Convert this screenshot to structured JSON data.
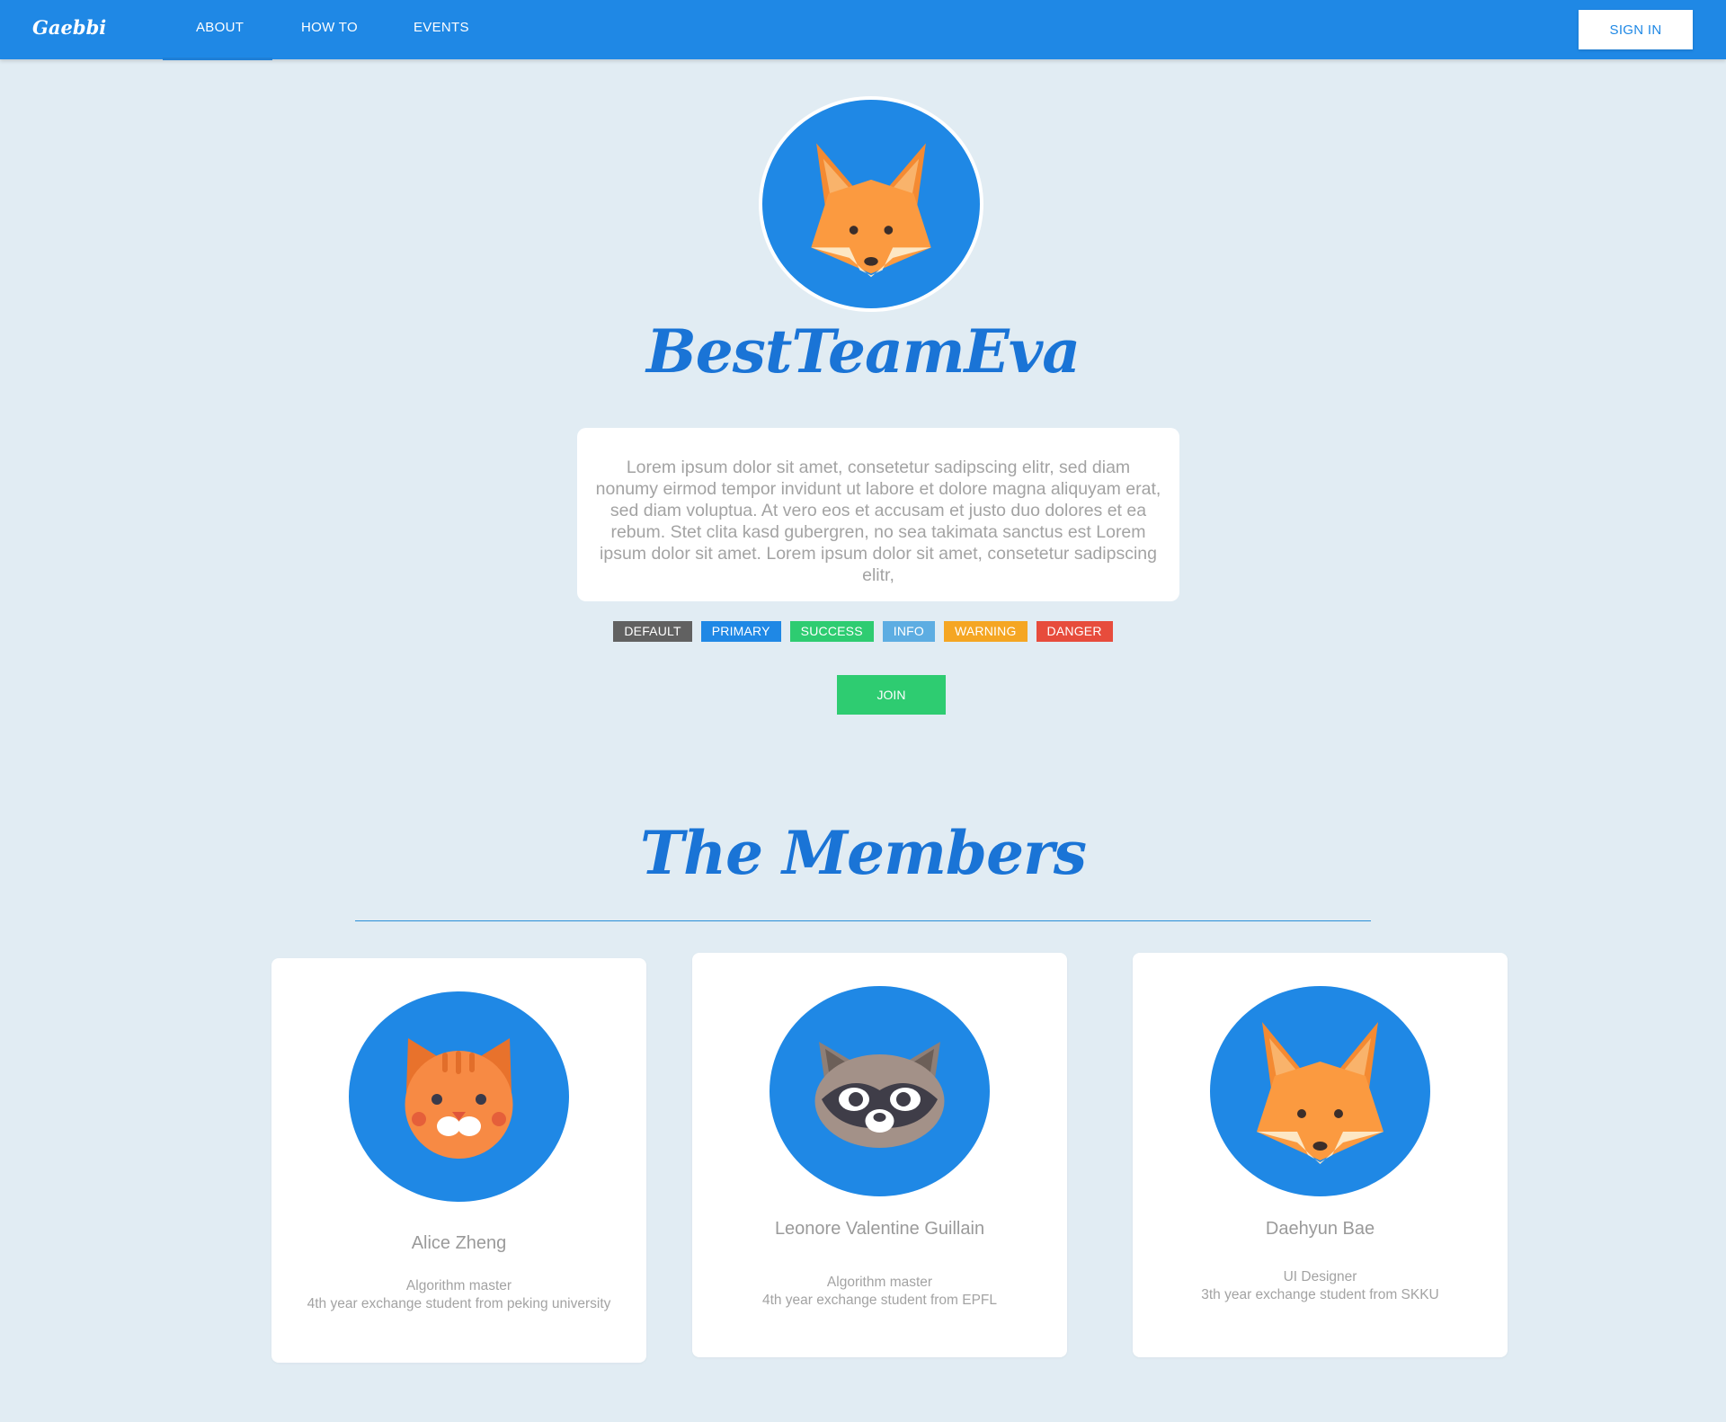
{
  "navbar": {
    "brand": "Gaebbi",
    "links": [
      {
        "label": "ABOUT",
        "active": true
      },
      {
        "label": "HOW TO",
        "active": false
      },
      {
        "label": "EVENTS",
        "active": false
      }
    ],
    "signin_label": "SIGN IN"
  },
  "hero": {
    "avatar_icon": "fox-icon",
    "team_name": "BestTeamEva",
    "description": "Lorem ipsum dolor sit amet, consetetur sadipscing elitr, sed diam nonumy eirmod tempor invidunt ut labore et dolore magna aliquyam erat, sed diam voluptua. At vero eos et accusam et justo duo dolores et ea rebum. Stet clita kasd gubergren, no sea takimata sanctus est Lorem ipsum dolor sit amet. Lorem ipsum dolor sit amet, consetetur sadipscing elitr,",
    "tags": [
      {
        "label": "DEFAULT",
        "color": "#616161"
      },
      {
        "label": "PRIMARY",
        "color": "#1f88e5"
      },
      {
        "label": "SUCCESS",
        "color": "#2ecc71"
      },
      {
        "label": "INFO",
        "color": "#5dade2"
      },
      {
        "label": "WARNING",
        "color": "#f5a623"
      },
      {
        "label": "DANGER",
        "color": "#e74c3c"
      }
    ],
    "join_label": "JOIN"
  },
  "members": {
    "title": "The Members",
    "list": [
      {
        "name": "Alice Zheng",
        "role": "Algorithm master",
        "bio": "4th year exchange student from peking university",
        "icon": "cat-icon"
      },
      {
        "name": "Leonore Valentine Guillain",
        "role": "Algorithm master",
        "bio": "4th year exchange student from EPFL",
        "icon": "raccoon-icon"
      },
      {
        "name": "Daehyun Bae",
        "role": "UI Designer",
        "bio": "3th year exchange student from SKKU",
        "icon": "fox-icon"
      }
    ]
  },
  "colors": {
    "primary": "#1f88e5",
    "background": "#e1ecf3",
    "title": "#1a74d6",
    "success": "#2ecc71"
  }
}
